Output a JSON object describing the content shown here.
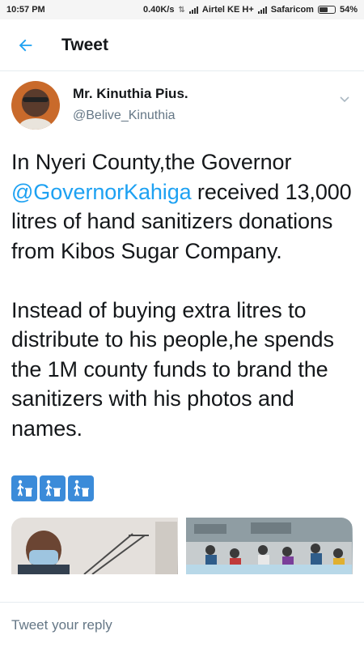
{
  "status_bar": {
    "time": "10:57 PM",
    "speed": "0.40K/s",
    "carrier1": "Airtel KE H+",
    "carrier2": "Safaricom",
    "battery": "54%"
  },
  "header": {
    "title": "Tweet",
    "back_icon": "arrow-left-icon",
    "accent": "#1da1f2"
  },
  "tweet": {
    "display_name": "Mr. Kinuthia Pius.",
    "handle": "@Belive_Kinuthia",
    "text_before_mention": "In Nyeri County,the Governor ",
    "mention": "@GovernorKahiga",
    "text_after_mention": " received 13,000 litres of hand sanitizers donations from Kibos Sugar Company.\n\nInstead of buying extra litres to distribute to his people,he spends the 1M county funds to brand the sanitizers with his photos and names.",
    "emojis": [
      "put-litter-in-its-place-icon",
      "put-litter-in-its-place-icon",
      "put-litter-in-its-place-icon"
    ]
  },
  "reply": {
    "placeholder": "Tweet your reply"
  }
}
